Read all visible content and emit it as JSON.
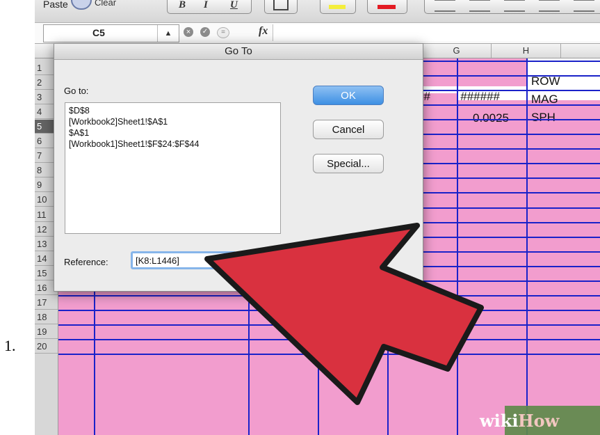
{
  "list_marker": "1.",
  "ribbon": {
    "paste_label": "Paste",
    "clear_label": "Clear",
    "bold_label": "B",
    "italic_label": "I",
    "underline_label": "U"
  },
  "formula_bar": {
    "name_box": "C5",
    "fx_label": "fx"
  },
  "columns": [
    "G",
    "H"
  ],
  "rows": [
    "1",
    "2",
    "3",
    "4",
    "5",
    "6",
    "7",
    "8",
    "9",
    "10",
    "11",
    "12",
    "13",
    "14",
    "15",
    "16",
    "17",
    "18",
    "19",
    "20"
  ],
  "active_row": "5",
  "cells": {
    "g2": "######",
    "h2": "######",
    "h3": "0.0025",
    "i1": "ROW",
    "i2": "MAG",
    "i3": "SPH"
  },
  "dialog": {
    "title": "Go To",
    "goto_label": "Go to:",
    "goto_items": [
      "$D$8",
      "[Workbook2]Sheet1!$A$1",
      "$A$1",
      "[Workbook1]Sheet1!$F$24:$F$44"
    ],
    "ok_label": "OK",
    "cancel_label": "Cancel",
    "special_label": "Special...",
    "reference_label": "Reference:",
    "reference_value": "[K8:L1446]"
  },
  "annotation": {
    "arrow_color": "#d9313f"
  },
  "watermark": {
    "wiki": "wiki",
    "how": "How"
  },
  "colors": {
    "cell_fill": "#f29dce",
    "grid_line": "#1a22c9",
    "ok_button": "#3d8fe3"
  }
}
